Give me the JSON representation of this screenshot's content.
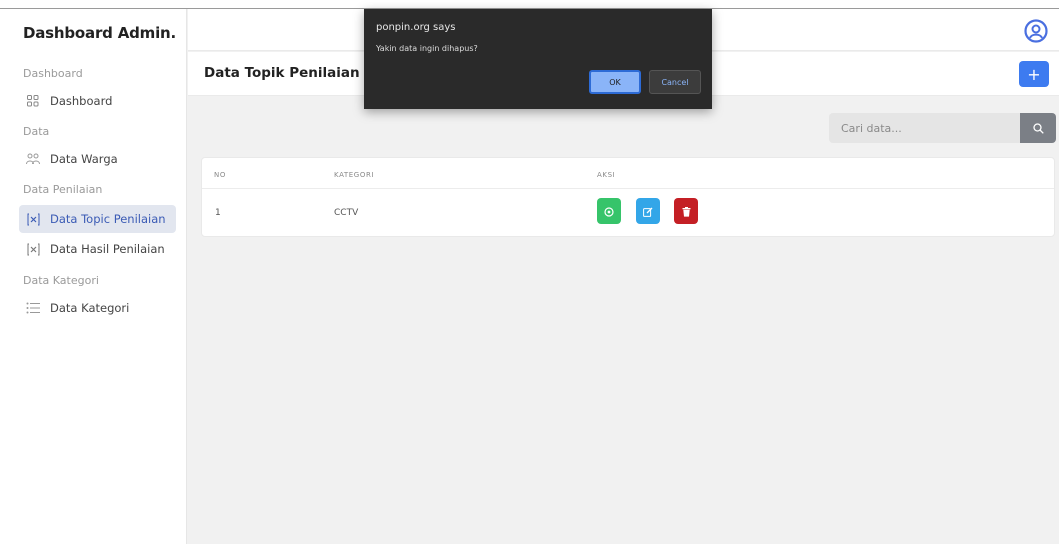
{
  "sidebar": {
    "brand": "Dashboard Admin.",
    "sections": [
      {
        "title": "Dashboard",
        "items": [
          {
            "label": "Dashboard",
            "icon": "grid-icon"
          }
        ]
      },
      {
        "title": "Data",
        "items": [
          {
            "label": "Data Warga",
            "icon": "users-icon"
          }
        ]
      },
      {
        "title": "Data Penilaian",
        "items": [
          {
            "label": "Data Topic Penilaian",
            "icon": "x-box-icon",
            "active": true
          },
          {
            "label": "Data Hasil Penilaian",
            "icon": "x-box-icon"
          }
        ]
      },
      {
        "title": "Data Kategori",
        "items": [
          {
            "label": "Data Kategori",
            "icon": "list-icon"
          }
        ]
      }
    ]
  },
  "header": {
    "avatar_icon": "user-circle-icon"
  },
  "page": {
    "title": "Data Topik Penilaian",
    "add_label": "+"
  },
  "search": {
    "placeholder": "Cari data..."
  },
  "table": {
    "headers": [
      "NO",
      "KATEGORI",
      "AKSI"
    ],
    "rows": [
      {
        "no": "1",
        "kategori": "CCTV"
      }
    ]
  },
  "dialog": {
    "title": "ponpin.org says",
    "message": "Yakin data  ingin dihapus?",
    "ok_label": "OK",
    "cancel_label": "Cancel"
  },
  "colors": {
    "accent": "#3d7bf0",
    "view": "#36c46a",
    "edit": "#33a6e8",
    "delete": "#c41f25",
    "active_bg": "#e2e6ef",
    "active_text": "#3b5bb5"
  }
}
